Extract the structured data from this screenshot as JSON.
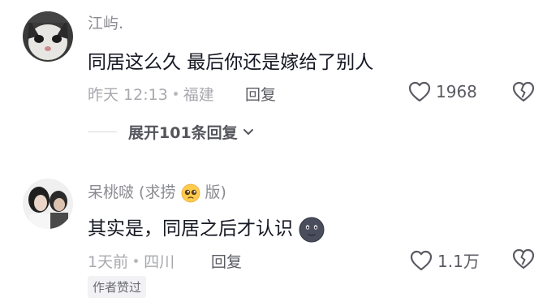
{
  "comments": [
    {
      "username": "江屿.",
      "text": "同居这么久 最后你还是嫁给了别人",
      "time": "昨天 12:13",
      "location": "福建",
      "reply_label": "回复",
      "likes": "1968"
    },
    {
      "username_prefix": "呆桃啵 (求捞",
      "username_suffix": "版)",
      "text": "其实是，同居之后才认识",
      "time": "1天前",
      "location": "四川",
      "reply_label": "回复",
      "likes": "1.1万",
      "badge": "作者赞过"
    }
  ],
  "expand_replies": "展开101条回复",
  "icons": {
    "like": "heart-outline-icon",
    "dislike": "broken-heart-icon",
    "expand": "chevron-down-icon",
    "pleading_emoji": "pleading-face-emoji",
    "moon_emoji": "new-moon-face-emoji"
  }
}
